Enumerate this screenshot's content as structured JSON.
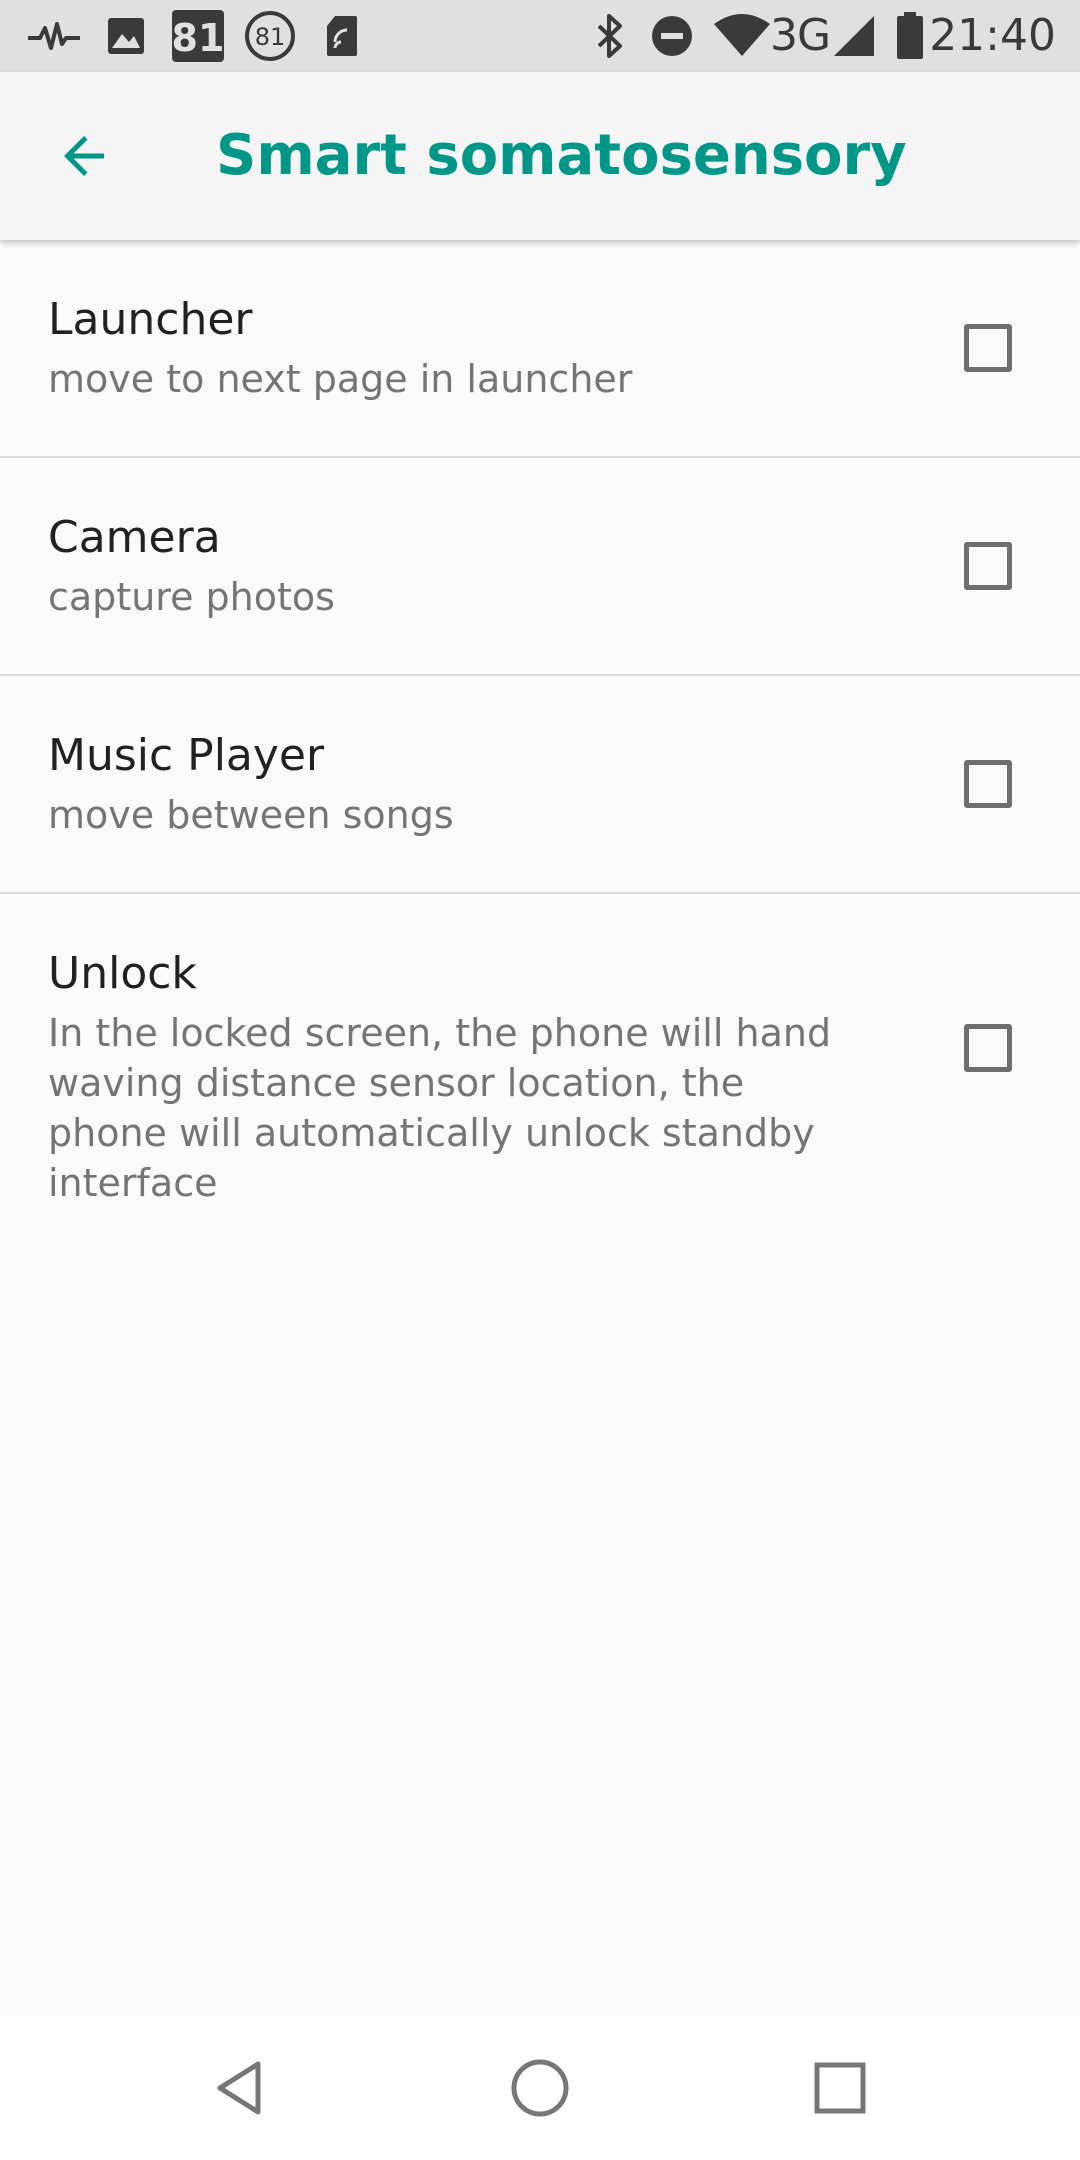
{
  "status_bar": {
    "time": "21:40",
    "network": "3G",
    "left_icons": [
      "pulse-icon",
      "image-icon",
      "aqi-badge-icon",
      "aqi-circle-icon",
      "sd-card-icon"
    ],
    "right_icons": [
      "bluetooth-icon",
      "do-not-disturb-icon",
      "wifi-icon",
      "cellular-signal-icon",
      "battery-icon"
    ],
    "badge_number": "81",
    "circle_number": "81"
  },
  "toolbar": {
    "title": "Smart somatosensory",
    "accent_color": "#009688"
  },
  "settings": [
    {
      "title": "Launcher",
      "summary": "move to next page in launcher",
      "checked": false
    },
    {
      "title": "Camera",
      "summary": "capture photos",
      "checked": false
    },
    {
      "title": "Music Player",
      "summary": "move between songs",
      "checked": false
    },
    {
      "title": "Unlock",
      "summary": "In the locked screen, the phone will hand waving distance sensor location, the phone will automatically unlock standby interface",
      "checked": false
    }
  ],
  "nav_bar": {
    "buttons": [
      "back-triangle-icon",
      "home-circle-icon",
      "recents-square-icon"
    ]
  }
}
